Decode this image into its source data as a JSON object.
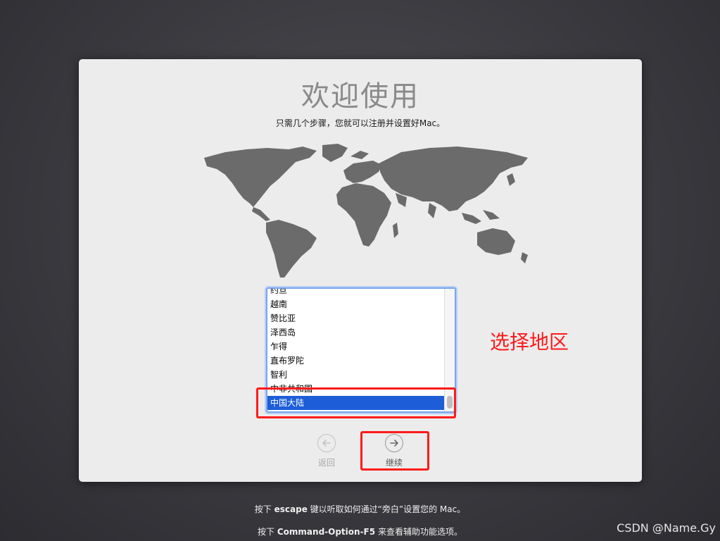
{
  "setup": {
    "title": "欢迎使用",
    "subtitle": "只需几个步骤，您就可以注册并设置好Mac。"
  },
  "region_list": {
    "items": [
      "约旦",
      "越南",
      "赞比亚",
      "泽西岛",
      "乍得",
      "直布罗陀",
      "智利",
      "中非共和国",
      "中国大陆"
    ],
    "selected": "中国大陆"
  },
  "nav": {
    "back_label": "返回",
    "continue_label": "继续"
  },
  "annotation": {
    "text": "选择地区",
    "color": "#ff1a1a"
  },
  "footer": {
    "line1": {
      "prefix": "按下",
      "key": "escape",
      "suffix": "键以听取如何通过“旁白”设置您的 Mac。"
    },
    "line2": {
      "prefix": "按下",
      "key": "Command-Option-F5",
      "suffix": "来查看辅助功能选项。"
    }
  },
  "watermark": "CSDN @Name.Gy",
  "colors": {
    "selection": "#1d5ed8",
    "focus_ring": "#7aa7ea",
    "map": "#6b6b6b"
  },
  "icons": {
    "back": "arrow-left-circle-icon",
    "continue": "arrow-right-circle-icon"
  }
}
